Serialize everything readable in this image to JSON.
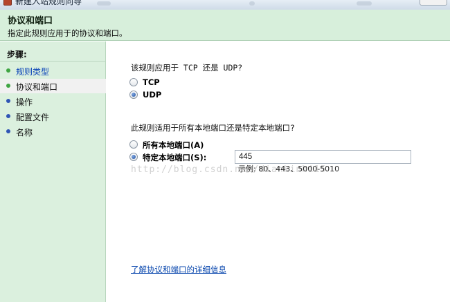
{
  "window": {
    "title": "新建入站规则向导"
  },
  "header": {
    "title": "协议和端口",
    "subtitle": "指定此规则应用于的协议和端口。"
  },
  "steps": {
    "heading": "步骤:",
    "items": [
      {
        "label": "规则类型",
        "state": "done"
      },
      {
        "label": "协议和端口",
        "state": "current"
      },
      {
        "label": "操作",
        "state": "pending"
      },
      {
        "label": "配置文件",
        "state": "pending"
      },
      {
        "label": "名称",
        "state": "pending"
      }
    ]
  },
  "protocol": {
    "question": "该规则应用于 TCP 还是 UDP?",
    "options": [
      {
        "label": "TCP",
        "checked": false
      },
      {
        "label": "UDP",
        "checked": true
      }
    ]
  },
  "ports": {
    "question": "此规则适用于所有本地端口还是特定本地端口?",
    "all_label": "所有本地端口(A)",
    "all_checked": false,
    "specific_label": "特定本地端口(S):",
    "specific_checked": true,
    "value": "445",
    "example": "示例: 80、443、5000-5010"
  },
  "watermark": "http://blog.csdn.net/diankinhi15",
  "link": {
    "label": "了解协议和端口的详细信息"
  },
  "colors": {
    "header_bg": "#d7efdb",
    "sidebar_bg": "#dbf0de",
    "link": "#0645ad",
    "done_bullet": "#3fa543",
    "pending_bullet": "#2f55b5"
  }
}
